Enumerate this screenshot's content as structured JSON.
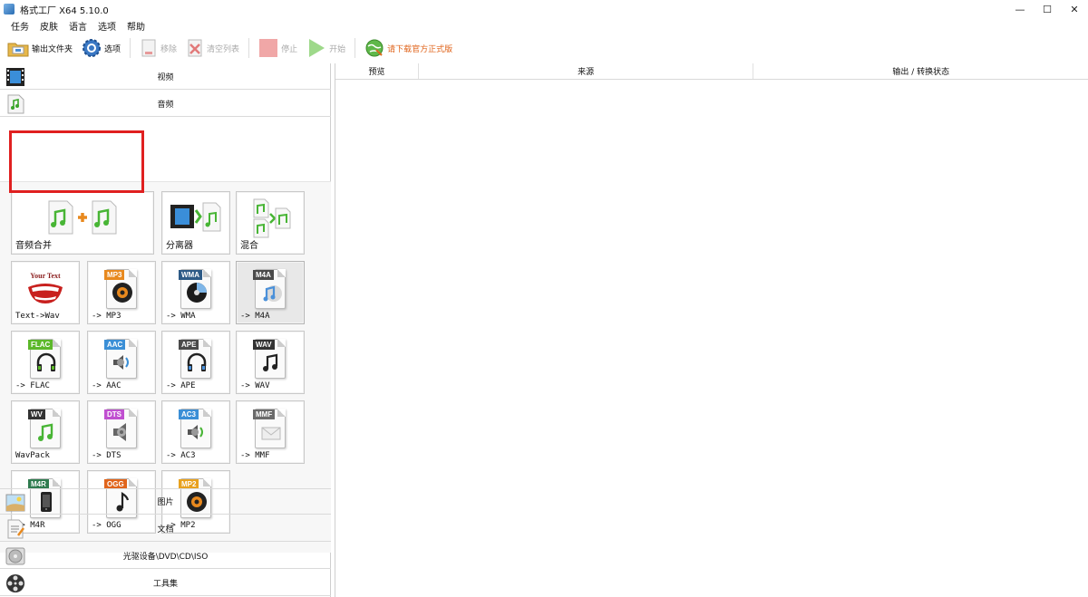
{
  "window": {
    "title": "格式工厂 X64 5.10.0",
    "controls": [
      "—",
      "☐",
      "✕"
    ]
  },
  "menu": [
    "任务",
    "皮肤",
    "语言",
    "选项",
    "帮助"
  ],
  "toolbar": {
    "output_folder": "输出文件夹",
    "options": "选项",
    "remove": "移除",
    "clear_list": "清空列表",
    "stop": "停止",
    "start": "开始",
    "promo": "请下载官方正式版"
  },
  "categories": {
    "video": "视频",
    "audio": "音频",
    "image": "图片",
    "document": "文档",
    "optical": "光驱设备\\DVD\\CD\\ISO",
    "tools": "工具集"
  },
  "tiles": {
    "merge": "音频合并",
    "splitter": "分离器",
    "mix": "混合",
    "text_wav": "Text->Wav",
    "mp3": "-> MP3",
    "wma": "-> WMA",
    "m4a": "-> M4A",
    "flac": "-> FLAC",
    "aac": "-> AAC",
    "ape": "-> APE",
    "wav": "-> WAV",
    "wavpack": "WavPack",
    "dts": "-> DTS",
    "ac3": "-> AC3",
    "mmf": "-> MMF",
    "m4r": "-> M4R",
    "ogg": "-> OGG",
    "mp2": "-> MP2"
  },
  "badges": {
    "mp3": "MP3",
    "wma": "WMA",
    "m4a": "M4A",
    "flac": "FLAC",
    "aac": "AAC",
    "ape": "APE",
    "wav": "WAV",
    "wv": "WV",
    "dts": "DTS",
    "ac3": "AC3",
    "mmf": "MMF",
    "m4r": "M4R",
    "ogg": "OGG",
    "mp2": "MP2",
    "your_text": "Your Text"
  },
  "badge_colors": {
    "mp3": "#e8891e",
    "wma": "#2d5a86",
    "m4a": "#4a4a4a",
    "flac": "#5cb82a",
    "aac": "#3b8fd6",
    "ape": "#4a4a4a",
    "wav": "#333333",
    "wv": "#333333",
    "dts": "#c04fd0",
    "ac3": "#3b8fd6",
    "mmf": "#6b6b6b",
    "m4r": "#2f7b4f",
    "ogg": "#e0641b",
    "mp2": "#e8a11e"
  },
  "table": {
    "columns": [
      "预览",
      "来源",
      "输出 / 转换状态"
    ]
  }
}
